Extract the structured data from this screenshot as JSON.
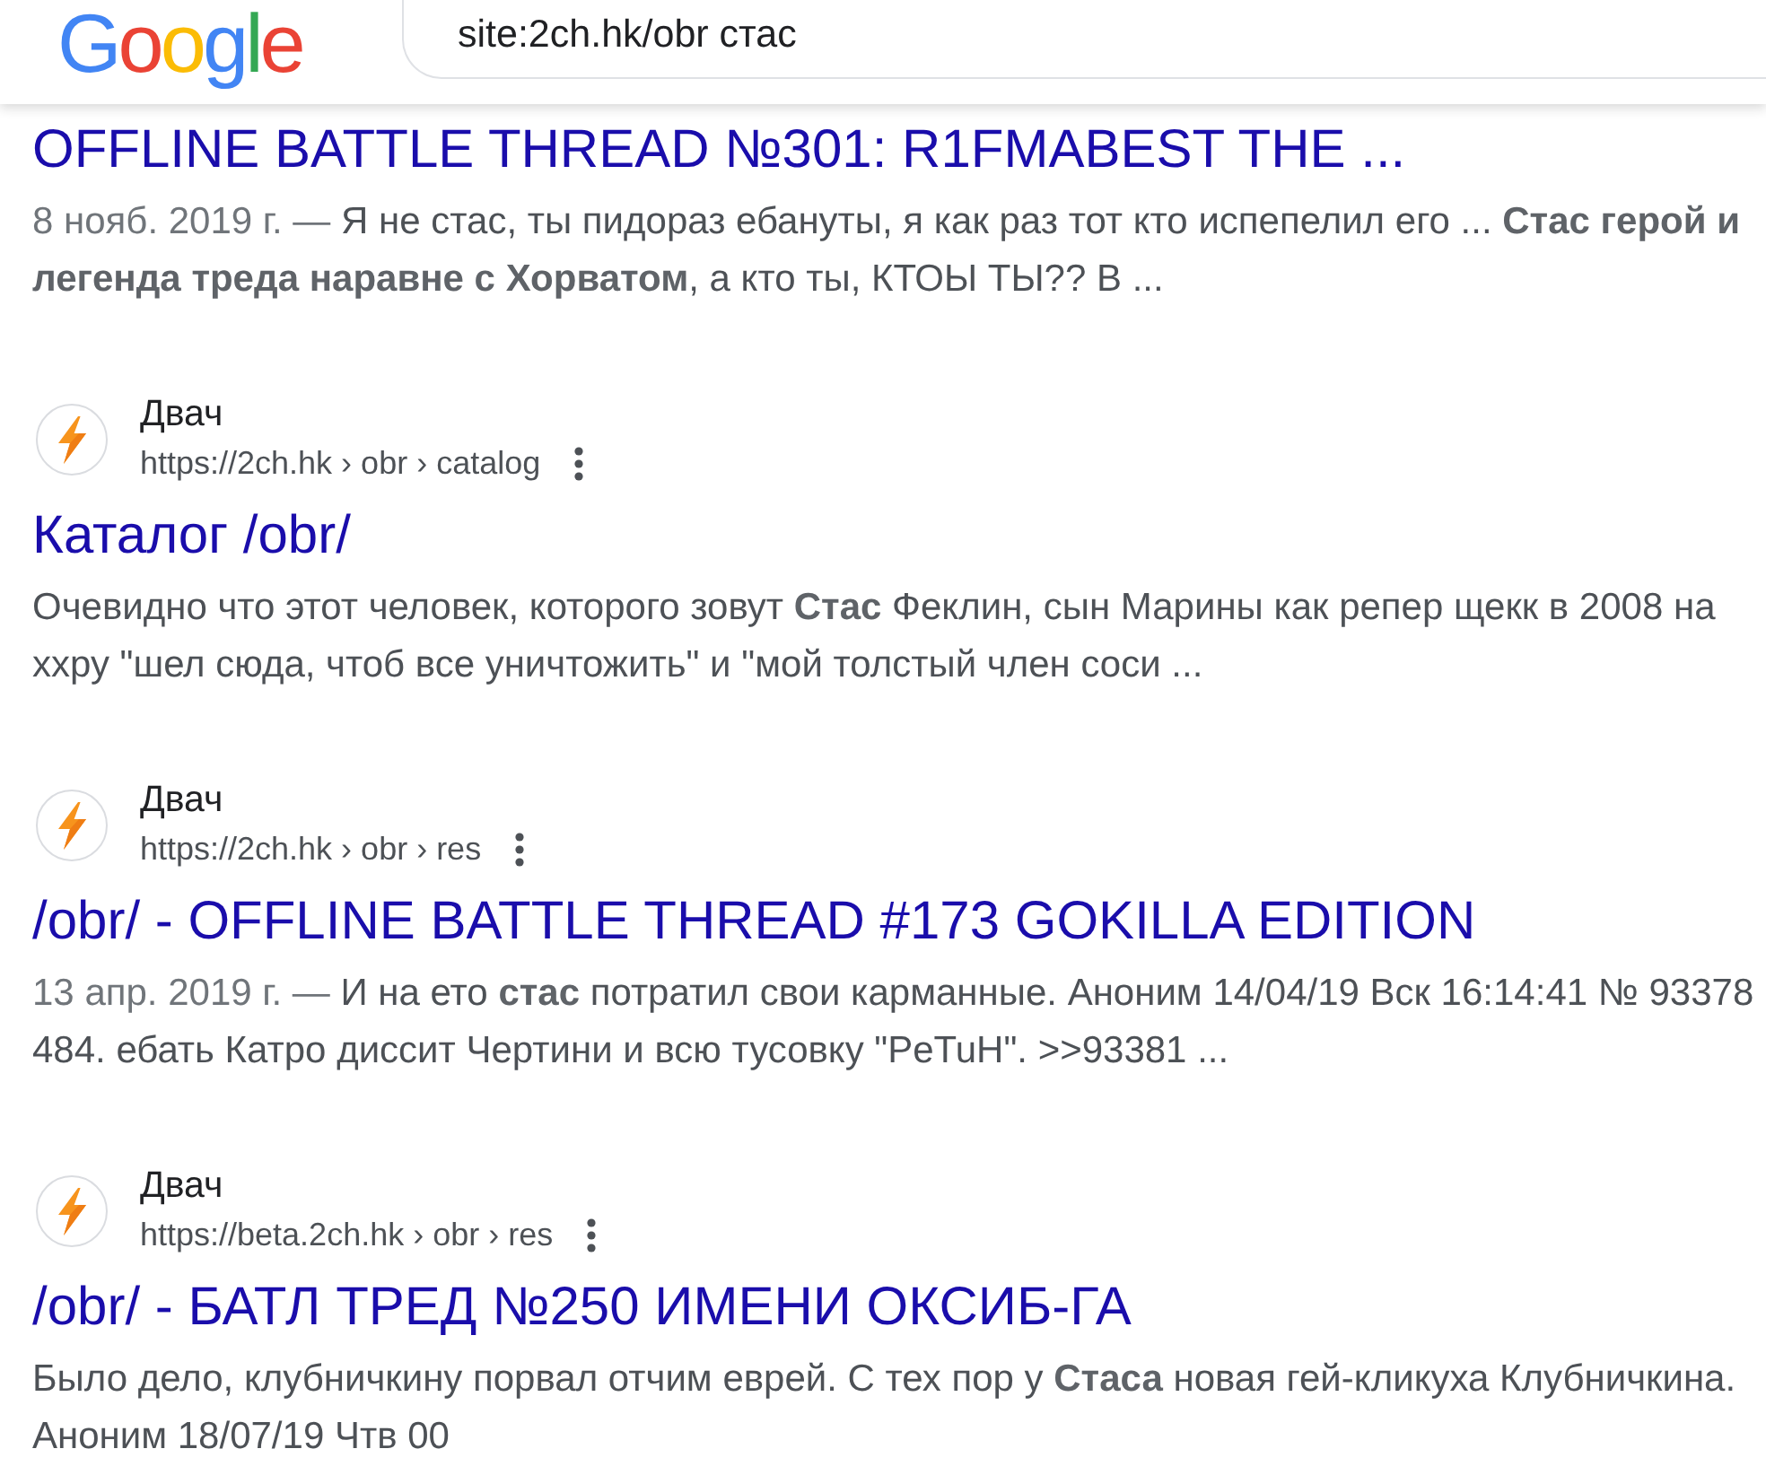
{
  "header": {
    "logo": "Google",
    "search": {
      "value": "site:2ch.hk/obr стас"
    }
  },
  "results": [
    {
      "title": "OFFLINE BATTLE THREAD №301: R1FMABEST THE ...",
      "date": "8 нояб. 2019 г. —",
      "snippet": "Я не стас, ты пидораз ебануты, я как раз тот кто испепелил его ... **Стас герой и легенда треда наравне с Хорватом**, а кто ты, КТОЫ ТЫ?? В ..."
    },
    {
      "site_name": "Двач",
      "url": "https://2ch.hk › obr › catalog",
      "title": "Каталог /obr/",
      "snippet": "Очевидно что этот человек, которого зовут **Стас** Феклин, сын Марины как репер щекк в 2008 на ххру \"шел сюда, чтоб все уничтожить\" и \"мой толстый член соси ..."
    },
    {
      "site_name": "Двач",
      "url": "https://2ch.hk › obr › res",
      "title": "/obr/ - OFFLINE BATTLE THREAD #173 GOKILLA EDITION",
      "date": "13 апр. 2019 г. —",
      "snippet": "И на ето **стас** потратил свои карманные. Аноним 14/04/19 Вск 16:14:41 № 93378 484. ебать Катро диссит Чертини и всю тусовку \"PeTuH\". >>93381 ..."
    },
    {
      "site_name": "Двач",
      "url": "https://beta.2ch.hk › obr › res",
      "title": "/obr/ - БАТЛ ТРЕД №250 ИМЕНИ ОКСИБ-ГА",
      "snippet": "Было дело, клубничкину порвал отчим еврей. С тех пор у **Стаса** новая гей-кликуха Клубничкина. Аноним 18/07/19 Чтв 00"
    }
  ]
}
